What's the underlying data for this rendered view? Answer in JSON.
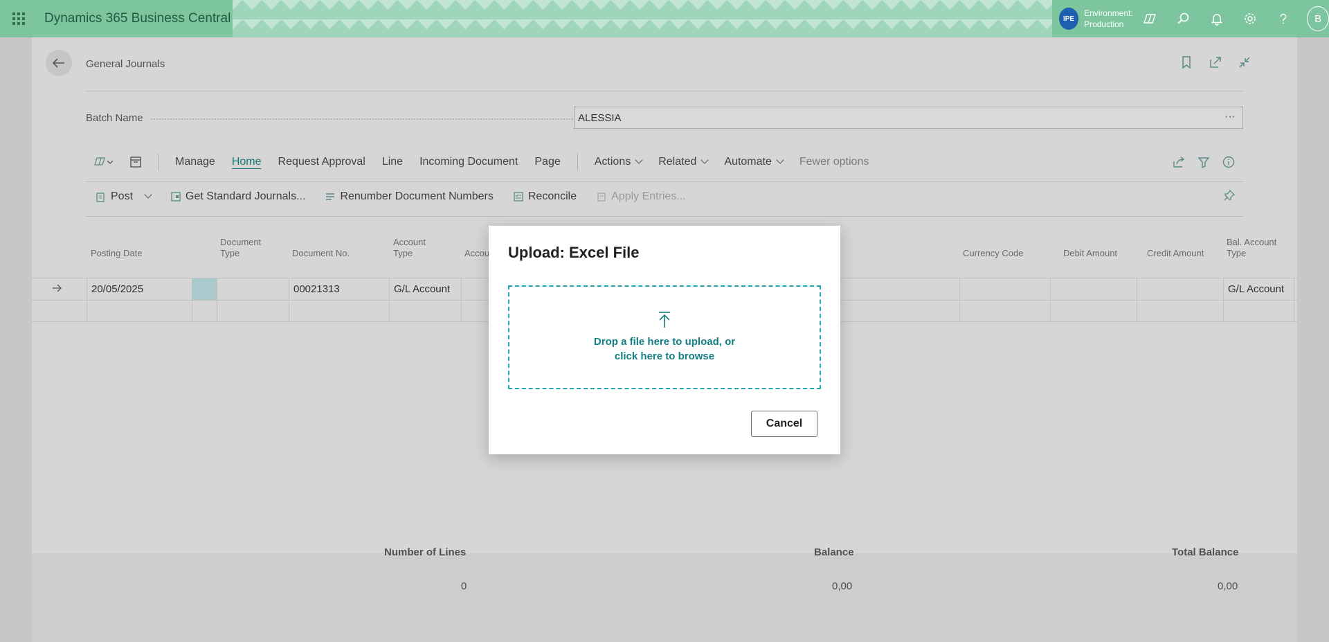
{
  "app": {
    "title": "Dynamics 365 Business Central",
    "environment_badge": "IPE",
    "environment_label": "Environment:",
    "environment_name": "Production",
    "avatar_initial": "B"
  },
  "page": {
    "title": "General Journals",
    "batch_label": "Batch Name",
    "batch_value": "ALESSIA",
    "batch_ellipsis": "···"
  },
  "actionbar": {
    "items": [
      "Manage",
      "Home",
      "Request Approval",
      "Line",
      "Incoming Document",
      "Page"
    ],
    "menus": [
      "Actions",
      "Related",
      "Automate"
    ],
    "fewer_options": "Fewer options"
  },
  "commands": {
    "post": "Post",
    "get_standard": "Get Standard Journals...",
    "renumber": "Renumber Document Numbers",
    "reconcile": "Reconcile",
    "apply_entries": "Apply Entries..."
  },
  "grid": {
    "headers": {
      "posting_date": "Posting Date",
      "document_type": "Document Type",
      "document_no": "Document No.",
      "account_type": "Account Type",
      "account_no": "Accou",
      "currency_code": "Currency Code",
      "debit_amount": "Debit Amount",
      "credit_amount": "Credit Amount",
      "bal_account_type": "Bal. Account Type"
    },
    "rows": [
      {
        "posting_date": "20/05/2025",
        "document_type": "",
        "document_no": "00021313",
        "account_type": "G/L Account",
        "bal_account_type": "G/L Account"
      }
    ]
  },
  "totals": {
    "lines_label": "Number of Lines",
    "lines_value": "0",
    "balance_label": "Balance",
    "balance_value": "0,00",
    "total_balance_label": "Total Balance",
    "total_balance_value": "0,00"
  },
  "dialog": {
    "title": "Upload: Excel File",
    "drop_text": "Drop a file here to upload, or click here to browse",
    "cancel_label": "Cancel",
    "accent_color": "#23a8ad"
  }
}
